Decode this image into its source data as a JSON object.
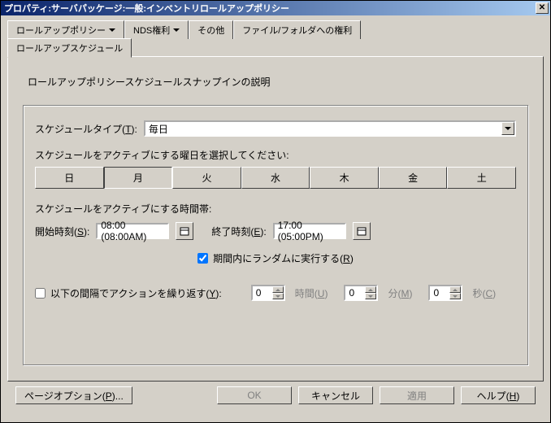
{
  "window": {
    "title": "プロパティ:サーバパッケージ:一般:インベントリロールアップポリシー"
  },
  "tabs": {
    "policy": "ロールアップポリシー",
    "nds": "NDS権利",
    "other": "その他",
    "filefolder": "ファイル/フォルダへの権利",
    "schedule": "ロールアップスケジュール"
  },
  "page": {
    "heading": "ロールアップポリシースケジュールスナップインの説明",
    "schedule_type_label": "スケジュールタイプ(",
    "schedule_type_key": "T",
    "schedule_type_label_end": "):",
    "schedule_type_value": "毎日",
    "active_days_label": "スケジュールをアクティブにする曜日を選択してください:",
    "days": {
      "sun": "日",
      "mon": "月",
      "tue": "火",
      "wed": "水",
      "thu": "木",
      "fri": "金",
      "sat": "土"
    },
    "time_range_label": "スケジュールをアクティブにする時間帯:",
    "start_label": "開始時刻(",
    "start_key": "S",
    "start_label_end": "):",
    "start_value": "08:00 (08:00AM)",
    "end_label": "終了時刻(",
    "end_key": "E",
    "end_label_end": "):",
    "end_value": "17:00 (05:00PM)",
    "random_label": "期間内にランダムに実行する(",
    "random_key": "R",
    "random_label_end": ")",
    "repeat_label_a": "以下の間隔でアクションを繰り返す(",
    "repeat_key": "Y",
    "repeat_label_b": "):",
    "hours_value": "0",
    "hours_unit": "時間(",
    "hours_key": "U",
    "minutes_value": "0",
    "minutes_unit": "分(",
    "minutes_key": "M",
    "seconds_value": "0",
    "seconds_unit": "秒(",
    "seconds_key": "C",
    "unit_close": ")"
  },
  "footer": {
    "page_options": "ページオプション(",
    "page_options_key": "P",
    "page_options_end": ")...",
    "ok": "OK",
    "cancel": "キャンセル",
    "apply": "適用",
    "help": "ヘルプ(",
    "help_key": "H",
    "help_end": ")"
  }
}
